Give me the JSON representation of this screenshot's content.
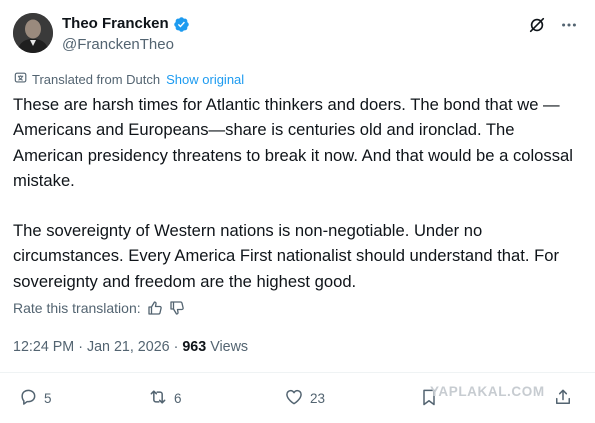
{
  "author": {
    "name": "Theo Francken",
    "handle": "@FranckenTheo"
  },
  "translation": {
    "label": "Translated from Dutch",
    "show_original": "Show original"
  },
  "post": {
    "paragraphs": [
      "These are harsh times for Atlantic thinkers and doers. The bond that we —Americans and Europeans—share is centuries old and ironclad. The American presidency threatens to break it now. And that would be a colossal mistake.",
      "The sovereignty of Western nations is non-negotiable. Under no circumstances. Every America First nationalist should understand that. For sovereignty and freedom are the highest good."
    ]
  },
  "rate_translation": "Rate this translation:",
  "meta": {
    "time": "12:24 PM",
    "date": "Jan 21, 2026",
    "separator": "·",
    "views_count": "963",
    "views_label": "Views"
  },
  "actions": {
    "replies": "5",
    "reposts": "6",
    "likes": "23"
  },
  "watermark": "YAPLAKAL.COM",
  "colors": {
    "text": "#0f1419",
    "secondary": "#536471",
    "accent": "#1d9bf0",
    "divider": "#eff3f4"
  },
  "icons": [
    "verified-badge-icon",
    "grok-icon",
    "more-icon",
    "translate-icon",
    "thumbs-up-icon",
    "thumbs-down-icon",
    "reply-icon",
    "repost-icon",
    "like-icon",
    "bookmark-icon",
    "share-icon"
  ]
}
